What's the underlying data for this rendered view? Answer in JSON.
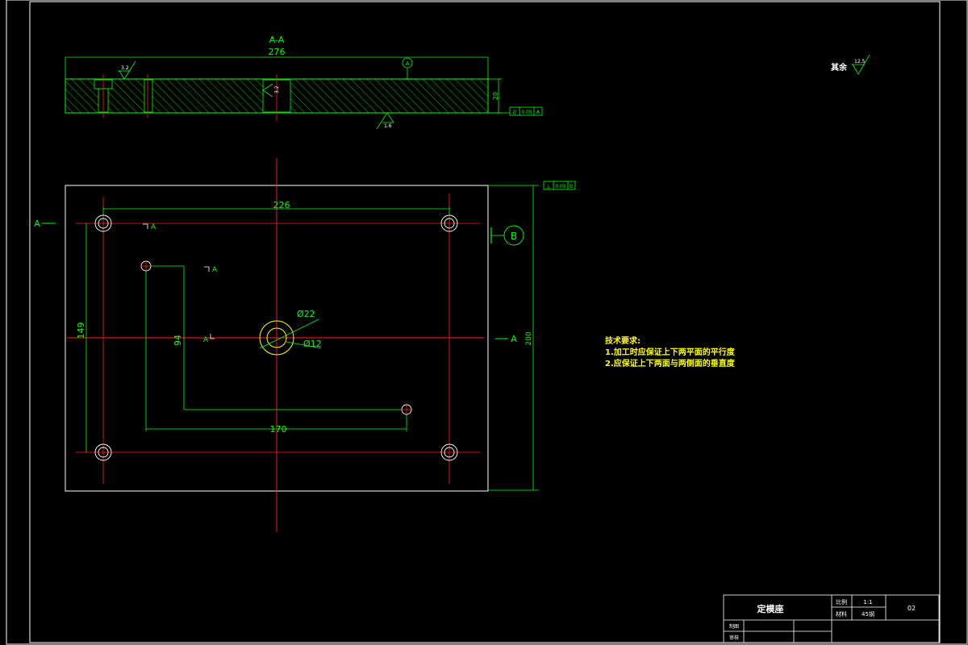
{
  "section": {
    "title": "A-A",
    "overall_length": "276",
    "thickness": "20",
    "datum": "A",
    "roughness_top": "3.2",
    "roughness_pocket": "3.2",
    "roughness_bottom": "1.6",
    "parallelism": {
      "symbol": "//",
      "value": "0.05",
      "datum": "A"
    }
  },
  "plan": {
    "section_mark": "A",
    "datum": "B",
    "perpendicularity": {
      "symbol": "⊥",
      "value": "0.05",
      "datum": "B"
    },
    "dim_hole_spacing_x": "226",
    "dim_hole_spacing_y": "149",
    "dim_offset_x": "170",
    "dim_offset_y": "94",
    "dim_height": "200",
    "dia_outer": "Ø22",
    "dia_inner": "Ø12"
  },
  "surface_finish_rest": {
    "label": "其余",
    "value": "12.5"
  },
  "tech_requirements": {
    "heading": "技术要求:",
    "items": [
      "1.加工时应保证上下两平面的平行度",
      "2.应保证上下两面与两侧面的垂直度"
    ]
  },
  "title_block": {
    "part_name": "定模座",
    "scale_label": "比例",
    "scale_value": "1:1",
    "material_label": "材料",
    "material_value": "45钢",
    "drawing_no": "02",
    "drawn_label": "制图",
    "checked_label": "审核"
  }
}
